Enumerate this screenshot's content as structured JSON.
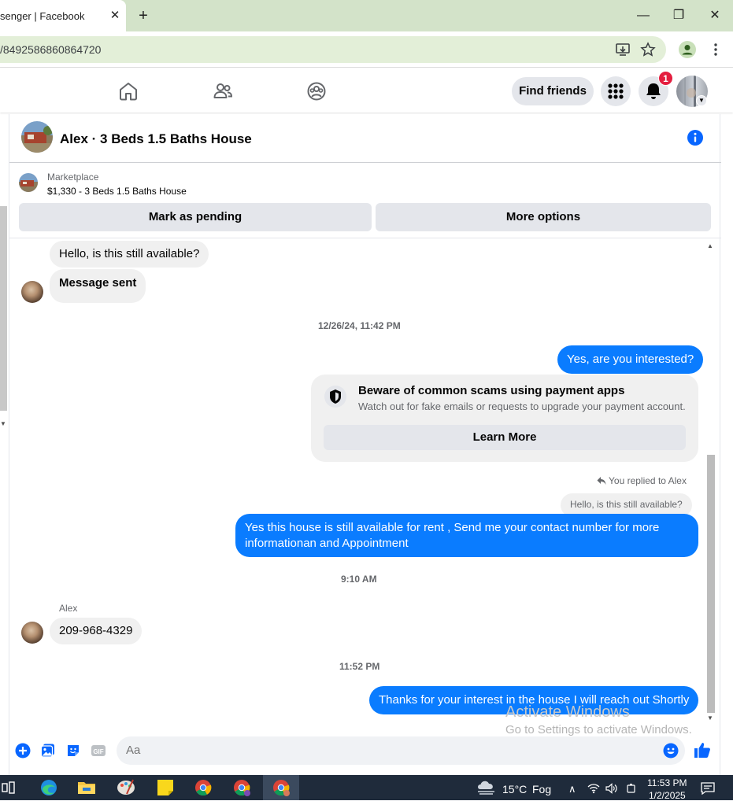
{
  "browser": {
    "tab_title": "senger | Facebook",
    "tab_close": "✕",
    "new_tab": "+",
    "url": "/8492586860864720",
    "window_minimize": "—",
    "window_restore": "❐",
    "window_close": "✕"
  },
  "facebook_header": {
    "find_friends_label": "Find friends",
    "notification_count": "1"
  },
  "chat": {
    "title": "Alex · 3 Beds 1.5 Baths House",
    "listing": {
      "source": "Marketplace",
      "title": "$1,330 - 3 Beds 1.5 Baths House",
      "mark_pending_label": "Mark as pending",
      "more_options_label": "More options"
    },
    "messages": {
      "m1": "Hello, is this still available?",
      "m2": "Message sent",
      "ts1": "12/26/24, 11:42 PM",
      "m3": "Yes, are you interested?",
      "scam_title": "Beware of common scams using payment apps",
      "scam_desc": "Watch out for fake emails or requests to upgrade your payment account.",
      "learn_more_label": "Learn More",
      "reply_note": "You replied to Alex",
      "quoted": "Hello, is this still available?",
      "m4_line1": "Yes this house is still available for rent , Send me your contact number for more",
      "m4_line2": "informationan and Appointment",
      "ts2": "9:10 AM",
      "sender_name": "Alex",
      "m5": "209-968-4329",
      "ts3": "11:52 PM",
      "m6": "Thanks for your interest in the house I will reach out Shortly"
    },
    "composer": {
      "placeholder": "Aa"
    }
  },
  "watermark": {
    "line1": "Activate Windows",
    "line2": "Go to Settings to activate Windows."
  },
  "taskbar": {
    "weather_temp": "15°C",
    "weather_cond": "Fog",
    "time": "11:53 PM",
    "date": "1/2/2025"
  },
  "colors": {
    "messenger_blue": "#0a7cff",
    "fb_blue": "#0866ff",
    "badge_red": "#e41e3f"
  }
}
